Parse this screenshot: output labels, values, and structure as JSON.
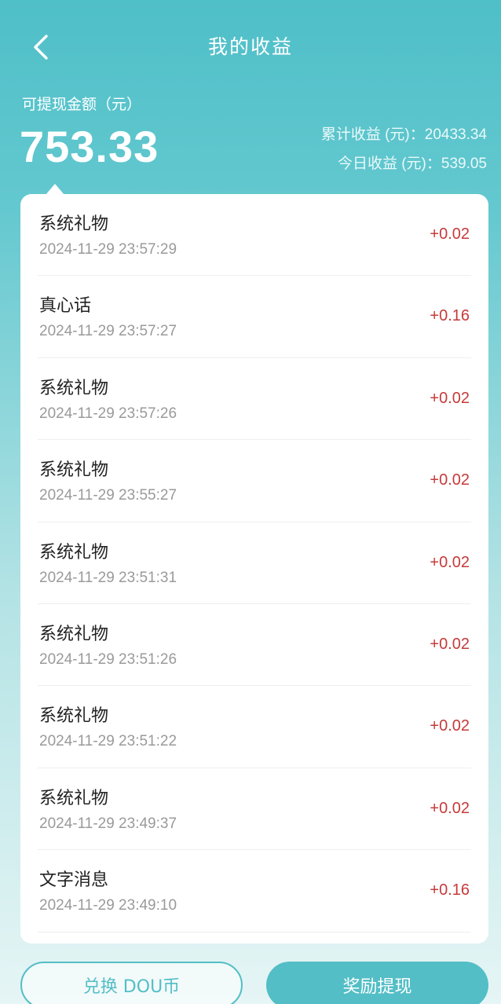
{
  "header": {
    "title": "我的收益",
    "back_icon": "chevron-left-icon"
  },
  "summary": {
    "available_label": "可提现金额（元）",
    "available_amount": "753.33",
    "total_earnings": "累计收益 (元)：20433.34",
    "today_earnings": "今日收益 (元)：539.05"
  },
  "records": [
    {
      "title": "系统礼物",
      "time": "2024-11-29 23:57:29",
      "amount": "+0.02"
    },
    {
      "title": "真心话",
      "time": "2024-11-29 23:57:27",
      "amount": "+0.16"
    },
    {
      "title": "系统礼物",
      "time": "2024-11-29 23:57:26",
      "amount": "+0.02"
    },
    {
      "title": "系统礼物",
      "time": "2024-11-29 23:55:27",
      "amount": "+0.02"
    },
    {
      "title": "系统礼物",
      "time": "2024-11-29 23:51:31",
      "amount": "+0.02"
    },
    {
      "title": "系统礼物",
      "time": "2024-11-29 23:51:26",
      "amount": "+0.02"
    },
    {
      "title": "系统礼物",
      "time": "2024-11-29 23:51:22",
      "amount": "+0.02"
    },
    {
      "title": "系统礼物",
      "time": "2024-11-29 23:49:37",
      "amount": "+0.02"
    },
    {
      "title": "文字消息",
      "time": "2024-11-29 23:49:10",
      "amount": "+0.16"
    }
  ],
  "actions": {
    "exchange_label": "兑换 DOU币",
    "withdraw_label": "奖励提现"
  },
  "colors": {
    "accent": "#53bec6",
    "amount": "#c63a3a"
  }
}
